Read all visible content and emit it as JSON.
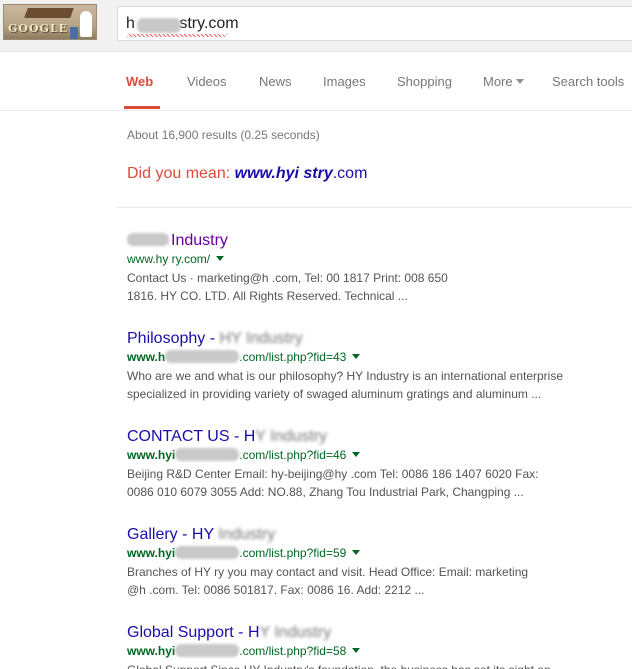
{
  "header": {
    "logo_text": "GOOGLE",
    "search_value": "h          stry.com"
  },
  "tabs": {
    "web": "Web",
    "videos": "Videos",
    "news": "News",
    "images": "Images",
    "shopping": "Shopping",
    "more": "More",
    "search_tools": "Search tools"
  },
  "stats": "About 16,900 results (0.25 seconds)",
  "did_you_mean": {
    "label": "Did you mean:",
    "suggestion_bold": "www.hyi        stry",
    "suggestion_rest": ".com"
  },
  "results": [
    {
      "title": "Industry",
      "url": "www.hy               ry.com/",
      "snippet_line1": "Contact Us · marketing@h                .com, Tel: 00              1817 Print: 008             650",
      "snippet_line2": "1816. HY                    CO. LTD. All Rights Reserved. Technical ..."
    },
    {
      "title": "Philosophy - ",
      "title_blur": "HY Industry",
      "url_prefix": "www.h",
      "url_suffix": ".com/list.php?fid=43",
      "snippet_line1": "Who are we and what is our philosophy? HY Industry is an international enterprise",
      "snippet_line2": "specialized in providing variety of swaged aluminum gratings and aluminum ..."
    },
    {
      "title": "CONTACT US - H",
      "title_blur": "Y Industry",
      "url_prefix": "www.hyi",
      "url_suffix": ".com/list.php?fid=46",
      "snippet_line1": "Beijing R&D Center Email: hy-beijing@hy             .com Tel: 0086 186 1407 6020 Fax:",
      "snippet_line2": "0086 010 6079 3055 Add: NO.88, Zhang Tou Industrial Park, Changping ..."
    },
    {
      "title": "Gallery - HY ",
      "title_blur": "Industry",
      "url_prefix": "www.hyi",
      "url_suffix": ".com/list.php?fid=59",
      "snippet_line1": "Branches of HY         ry you may contact and visit. Head Office: Email: marketing",
      "snippet_line2": "@h                .com. Tel: 0086            501817. Fax: 0086                16. Add: 2212 ..."
    },
    {
      "title": "Global Support - H",
      "title_blur": "Y Industry",
      "url_prefix": "www.hyi",
      "url_suffix": ".com/list.php?fid=58",
      "snippet_line1": "Global Support Since HY Industry's foundation, the business has set its sight on"
    }
  ],
  "colors": {
    "accent": "#dd4b39",
    "link": "#1a0dab",
    "visited": "#660099",
    "url_green": "#006621",
    "snippet": "#545454"
  }
}
